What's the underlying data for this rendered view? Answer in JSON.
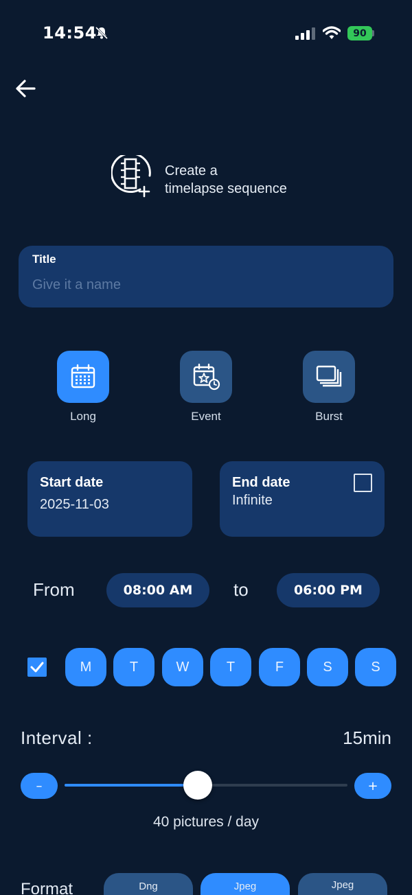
{
  "status_bar": {
    "time": "14:54",
    "battery": "90"
  },
  "header": {
    "title_line1": "Create a",
    "title_line2": "timelapse sequence"
  },
  "title_field": {
    "label": "Title",
    "placeholder": "Give it a name",
    "value": ""
  },
  "modes": [
    {
      "label": "Long",
      "icon": "calendar-icon",
      "active": true
    },
    {
      "label": "Event",
      "icon": "calendar-star-icon",
      "active": false
    },
    {
      "label": "Burst",
      "icon": "stack-icon",
      "active": false
    }
  ],
  "dates": {
    "start_label": "Start date",
    "start_value": "2025-11-03",
    "end_label": "End date",
    "end_value": "Infinite",
    "end_enabled": false
  },
  "time_range": {
    "from_label": "From",
    "from_value": "08:00 AM",
    "to_label": "to",
    "to_value": "06:00 PM"
  },
  "days": {
    "all_checked": true,
    "items": [
      "M",
      "T",
      "W",
      "T",
      "F",
      "S",
      "S"
    ]
  },
  "interval": {
    "label": "Interval :",
    "value": "15min",
    "minus": "–",
    "plus": "+",
    "slider_fraction": 0.47,
    "pictures_per_day": "40 pictures / day"
  },
  "format": {
    "label": "Format",
    "options": [
      {
        "label": "Dng",
        "active": false
      },
      {
        "label": "Jpeg",
        "active": true
      },
      {
        "label": "Jpeg",
        "active": false
      }
    ]
  },
  "colors": {
    "background": "#0b1a2f",
    "card": "#16386a",
    "accent": "#2f8cff",
    "inactive_button": "#2b5586"
  }
}
